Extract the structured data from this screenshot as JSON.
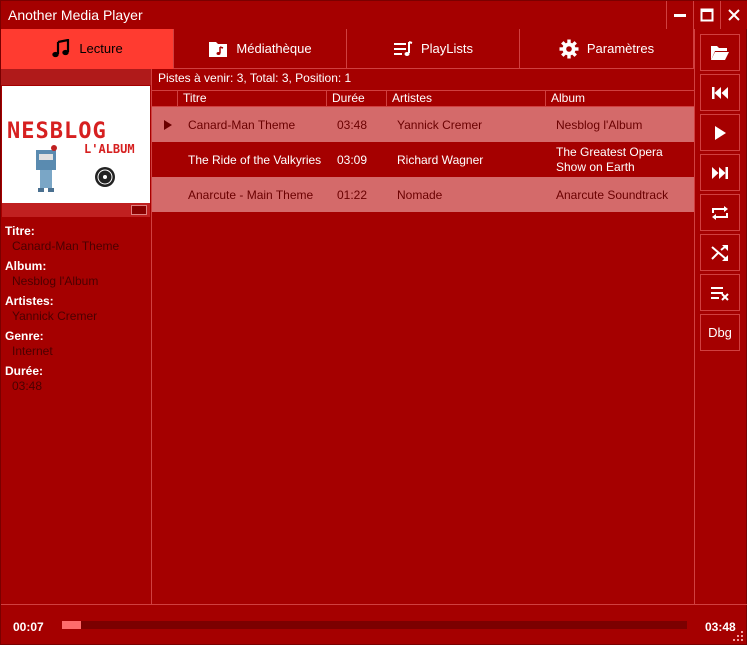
{
  "window": {
    "title": "Another Media Player"
  },
  "tabs": [
    {
      "label": "Lecture",
      "icon": "music-note-icon",
      "active": true
    },
    {
      "label": "Médiathèque",
      "icon": "music-folder-icon",
      "active": false
    },
    {
      "label": "PlayLists",
      "icon": "playlist-icon",
      "active": false
    },
    {
      "label": "Paramètres",
      "icon": "gear-icon",
      "active": false
    }
  ],
  "toolbar": {
    "debug_label": "Dbg"
  },
  "queue": {
    "info": "Pistes à venir:  3, Total:  3, Position: 1"
  },
  "columns": {
    "title": "Titre",
    "duration": "Durée",
    "artists": "Artistes",
    "album": "Album"
  },
  "tracks": [
    {
      "title": "Canard-Man Theme",
      "duration": "03:48",
      "artist": "Yannick Cremer",
      "album": "Nesblog l'Album"
    },
    {
      "title": "The Ride of the Valkyries",
      "duration": "03:09",
      "artist": "Richard Wagner",
      "album_line1": "The Greatest Opera",
      "album_line2": "Show on Earth"
    },
    {
      "title": "Anarcute - Main Theme",
      "duration": "01:22",
      "artist": "Nomade",
      "album": "Anarcute Soundtrack"
    }
  ],
  "cover": {
    "logo_text": "NESBLOG",
    "logo_sub": "L'ALBUM"
  },
  "details": {
    "title_label": "Titre:",
    "title_value": "Canard-Man Theme",
    "album_label": "Album:",
    "album_value": "Nesblog l'Album",
    "artists_label": "Artistes:",
    "artists_value": "Yannick Cremer",
    "genre_label": "Genre:",
    "genre_value": "Internet",
    "duration_label": "Durée:",
    "duration_value": "03:48"
  },
  "playback": {
    "current_time": "00:07",
    "total_time": "03:48",
    "progress": 0.03
  },
  "colors": {
    "background": "#a50000",
    "active_tab": "#ff3b30",
    "row_highlight": "#d46a6a",
    "progress_fill": "#ff6b6b",
    "progress_track": "#7c0000"
  }
}
